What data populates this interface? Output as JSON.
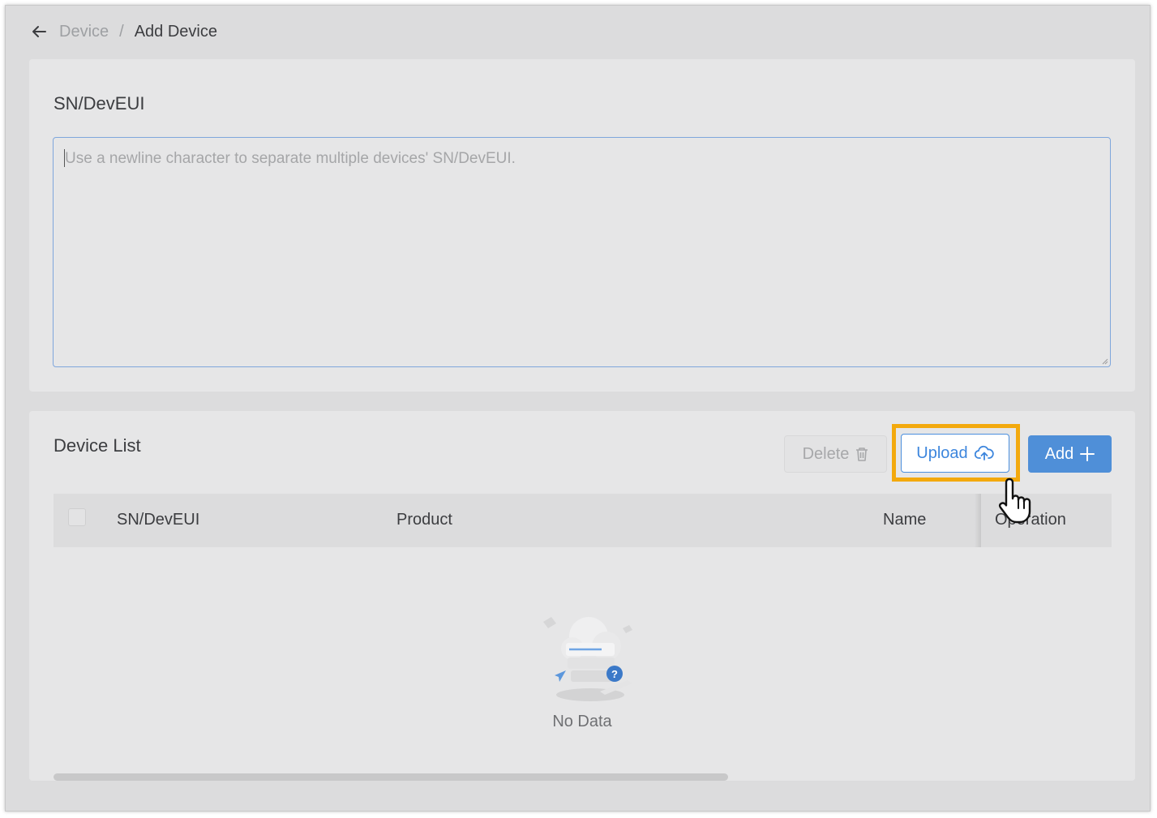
{
  "breadcrumb": {
    "parent": "Device",
    "separator": "/",
    "current": "Add Device"
  },
  "sn_section": {
    "title": "SN/DevEUI",
    "textarea_placeholder": "Use a newline character to separate multiple devices' SN/DevEUI."
  },
  "device_list": {
    "title": "Device List",
    "buttons": {
      "delete": "Delete",
      "upload": "Upload",
      "add": "Add"
    },
    "columns": [
      "SN/DevEUI",
      "Product",
      "Name",
      "Operation"
    ],
    "empty_text": "No Data"
  },
  "colors": {
    "primary": "#4f8fd8",
    "highlight": "#f3a90d"
  },
  "icons": [
    "back-arrow-icon",
    "trash-icon",
    "cloud-upload-icon",
    "plus-icon",
    "no-data-illustration",
    "hand-pointer-icon"
  ]
}
